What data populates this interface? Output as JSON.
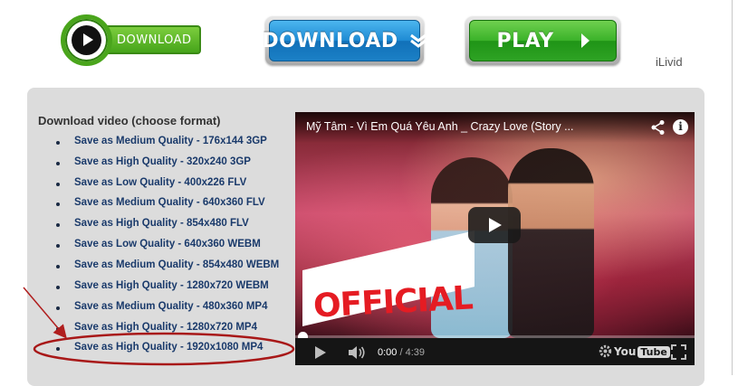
{
  "buttons": {
    "green_download_label": "DOWNLOAD",
    "blue_download_label": "DOWNLOAD",
    "play_label": "PLAY"
  },
  "brand_text": "iLivid",
  "download_section": {
    "title": "Download video (choose format)",
    "formats": [
      "Save as Medium Quality - 176x144 3GP",
      "Save as High Quality - 320x240 3GP",
      "Save as Low Quality - 400x226 FLV",
      "Save as Medium Quality - 640x360 FLV",
      "Save as High Quality - 854x480 FLV",
      "Save as Low Quality - 640x360 WEBM",
      "Save as Medium Quality - 854x480 WEBM",
      "Save as High Quality - 1280x720 WEBM",
      "Save as Medium Quality - 480x360 MP4",
      "Save as High Quality - 1280x720 MP4",
      "Save as High Quality - 1920x1080 MP4"
    ],
    "highlighted_format_index": 10
  },
  "video": {
    "title": "Mỹ Tâm - Vì Em Quá Yêu Anh _ Crazy Love (Story ...",
    "overlay_text": "OFFICIAL",
    "current_time": "0:00",
    "separator": " / ",
    "duration": "4:39",
    "youtube_you": "You",
    "youtube_tube": "Tube",
    "progress_fraction": 0.0
  },
  "icons": {
    "share": "share-icon",
    "info": "info-icon",
    "info_glyph": "i",
    "play": "play-icon",
    "volume": "volume-icon",
    "settings": "gear-icon",
    "fullscreen": "fullscreen-icon",
    "download_arrow": "chevron-down-icon"
  },
  "colors": {
    "annotation_red": "#b01e1e",
    "link_blue": "#1a3a6b",
    "panel_gray": "#dcdcdc"
  }
}
